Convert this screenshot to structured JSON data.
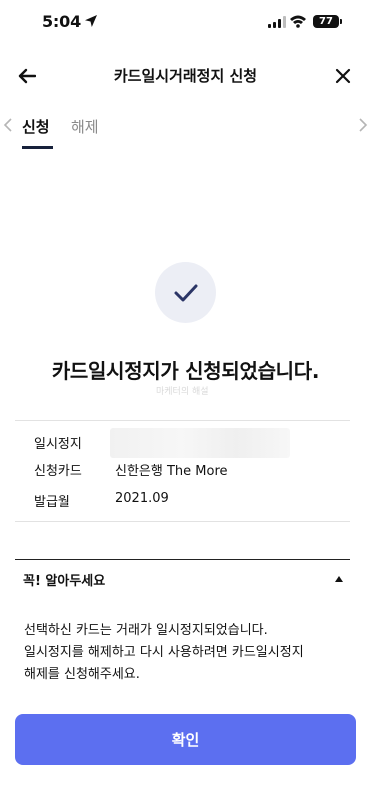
{
  "status_bar": {
    "time": "5:04",
    "battery": "77"
  },
  "header": {
    "title": "카드일시거래정지 신청",
    "back_icon": "arrow-left-icon",
    "close_icon": "close-icon"
  },
  "tabs": [
    {
      "label": "신청",
      "active": true
    },
    {
      "label": "해제",
      "active": false
    }
  ],
  "result": {
    "icon": "checkmark-icon",
    "message": "카드일시정지가 신청되었습니다.",
    "watermark": "마케터의 해설"
  },
  "info": [
    {
      "label": "일시정지",
      "value": ""
    },
    {
      "label": "신청카드",
      "value": "신한은행 The More"
    },
    {
      "label": "발급월",
      "value": "2021.09"
    }
  ],
  "notice": {
    "title": "꼭! 알아두세요",
    "expanded": true,
    "lines": [
      "선택하신 카드는 거래가 일시정지되었습니다.",
      "일시정지를 해제하고 다시 사용하려면 카드일시정지",
      "해제를 신청해주세요."
    ]
  },
  "confirm_button": {
    "label": "확인"
  },
  "colors": {
    "primary": "#5c6ff0",
    "tab_underline": "#17213b",
    "check_bg": "#eceef5",
    "check_stroke": "#2b3566"
  }
}
